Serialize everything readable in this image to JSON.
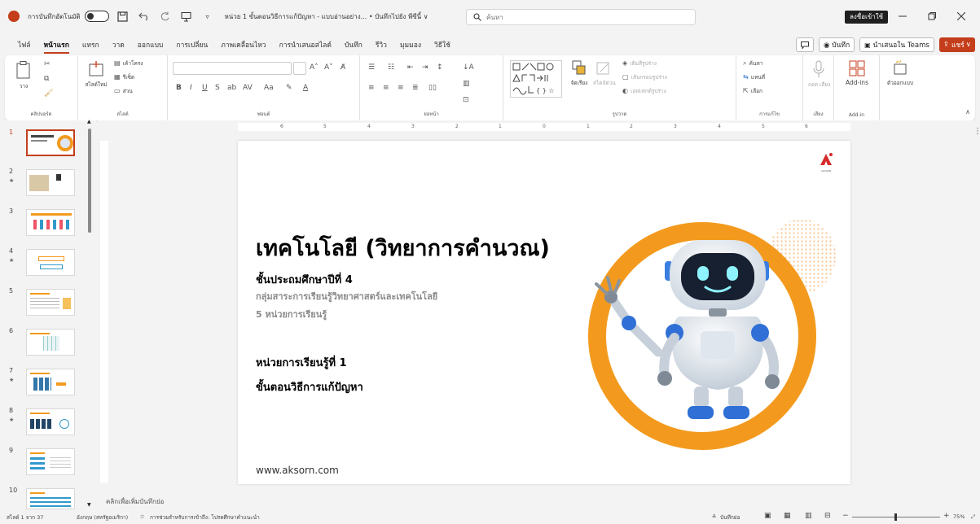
{
  "titlebar": {
    "autosave_label": "การบันทึกอัตโนมัติ",
    "doc_title": "หน่วย 1 ขั้นตอนวิธีการแก้ปัญหา - แบบอ่านอย่าง... • บันทึกไปยัง พีซีนี้ ∨",
    "search_placeholder": "ค้นหา",
    "signin_label": "ลงชื่อเข้าใช้"
  },
  "menu": {
    "tabs": [
      "ไฟล์",
      "หน้าแรก",
      "แทรก",
      "วาด",
      "ออกแบบ",
      "การเปลี่ยน",
      "ภาพเคลื่อนไหว",
      "การนำเสนอสไลด์",
      "บันทึก",
      "รีวิว",
      "มุมมอง",
      "วิธีใช้"
    ],
    "active_index": 1,
    "comment_icon": "comment-icon",
    "record_label": "◉ บันทึก",
    "teams_label": "นำเสนอใน Teams",
    "share_label": "แชร์"
  },
  "ribbon": {
    "clipboard": {
      "paste_label": "วาง",
      "group_label": "คลิปบอร์ด"
    },
    "slides": {
      "new_slide_label": "สไลด์ใหม่",
      "layout_label": "เค้าโครง",
      "reset_label": "รีเซ็ต",
      "section_label": "ส่วน",
      "group_label": "สไลด์"
    },
    "font": {
      "group_label": "ฟอนต์",
      "font_value": "",
      "size_value": ""
    },
    "paragraph": {
      "group_label": "ย่อหน้า"
    },
    "drawing": {
      "arrange_label": "จัดเรียง",
      "styles_label": "สไตล์ด่วน",
      "fill_label": "เติมสีรูปร่าง",
      "outline_label": "เส้นกรอบรูปร่าง",
      "effects_label": "เอฟเฟกต์รูปร่าง",
      "group_label": "รูปวาด"
    },
    "editing": {
      "find_label": "ค้นหา",
      "replace_label": "แทนที่",
      "select_label": "เลือก",
      "group_label": "การแก้ไข"
    },
    "voice": {
      "dictate_label": "ถอด เสียง",
      "group_label": "เสียง"
    },
    "addins": {
      "addins_label": "Add-ins",
      "group_label": "Add-in"
    },
    "designer": {
      "label": "ตัวออกแบบ"
    }
  },
  "thumbnails": [
    {
      "num": "1",
      "star": false
    },
    {
      "num": "2",
      "star": true
    },
    {
      "num": "3",
      "star": false
    },
    {
      "num": "4",
      "star": true
    },
    {
      "num": "5",
      "star": false
    },
    {
      "num": "6",
      "star": false
    },
    {
      "num": "7",
      "star": true
    },
    {
      "num": "8",
      "star": true
    },
    {
      "num": "9",
      "star": false
    },
    {
      "num": "10",
      "star": false
    }
  ],
  "slide": {
    "title": "เทคโนโลยี (วิทยาการคำนวณ)",
    "grade": "ชั้นประถมศึกษาปีที่ 4",
    "subject": "กลุ่มสาระการเรียนรู้วิทยาศาสตร์และเทคโนโลยี",
    "units": "5 หน่วยการเรียนรู้",
    "unit_no": "หน่วยการเรียนรู้ที่ 1",
    "unit_name": "ขั้นตอนวิธีการแก้ปัญหา",
    "url": "www.aksorn.com",
    "logo_text": "AKSORN"
  },
  "ruler_numbers": [
    "6",
    "5",
    "4",
    "3",
    "2",
    "1",
    "0",
    "1",
    "2",
    "3",
    "4",
    "5",
    "6"
  ],
  "notes_hint": "คลิกเพื่อเพิ่มบันทึกย่อ",
  "status": {
    "slide_count": "สไลด์ 1 จาก 37",
    "language": "อังกฤษ (สหรัฐอเมริกา)",
    "accessibility": "การช่วยสำหรับการเข้าถึง: โปรดศึกษาคำแนะนำ",
    "notes_label": "บันทึกย่อ",
    "zoom": "75%"
  },
  "colors": {
    "accent": "#c43e1c",
    "orange": "#f39a1e"
  }
}
